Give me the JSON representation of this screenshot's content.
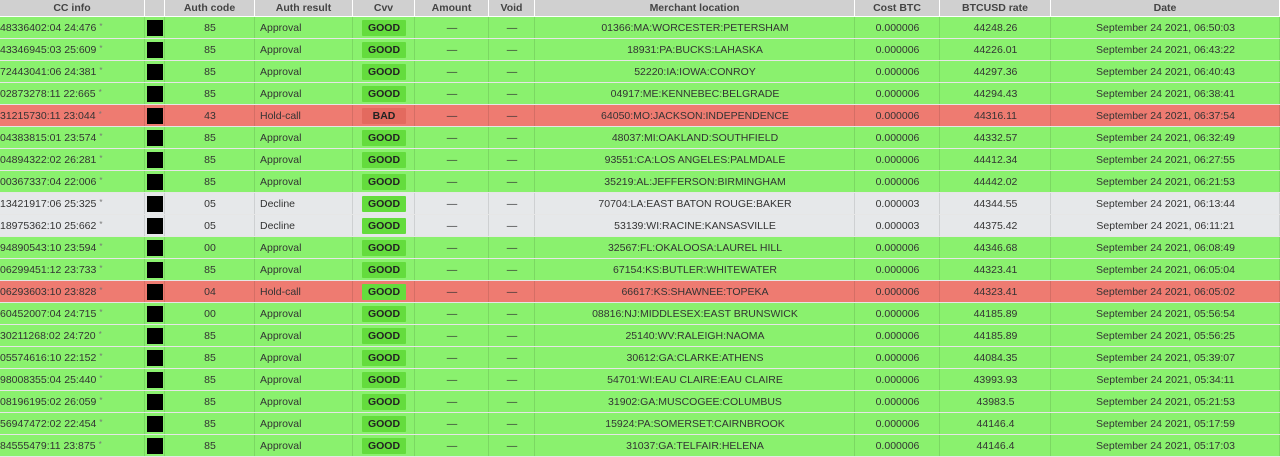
{
  "columns": [
    "CC info",
    "",
    "Auth code",
    "Auth result",
    "Cvv",
    "Amount",
    "Void",
    "Merchant location",
    "Cost BTC",
    "BTCUSD rate",
    "Date"
  ],
  "colors": {
    "approval": "#8af16e",
    "decline": "#e6e8ea",
    "hold": "#ee7b71",
    "cvv_good": "#64dc3d",
    "cvv_bad": "#e36a5f",
    "header": "#d0d0d0"
  },
  "rows": [
    {
      "status": "good",
      "cc": "48336402:04 24:476",
      "star": "*",
      "auth": "85",
      "result": "Approval",
      "cvv": "GOOD",
      "amount": "—",
      "void": "—",
      "merchant": "01366:MA:WORCESTER:PETERSHAM",
      "cost": "0.000006",
      "rate": "44248.26",
      "date": "September 24 2021, 06:50:03"
    },
    {
      "status": "good",
      "cc": "43346945:03 25:609",
      "star": "*",
      "auth": "85",
      "result": "Approval",
      "cvv": "GOOD",
      "amount": "—",
      "void": "—",
      "merchant": "18931:PA:BUCKS:LAHASKA",
      "cost": "0.000006",
      "rate": "44226.01",
      "date": "September 24 2021, 06:43:22"
    },
    {
      "status": "good",
      "cc": "72443041:06 24:381",
      "star": "*",
      "auth": "85",
      "result": "Approval",
      "cvv": "GOOD",
      "amount": "—",
      "void": "—",
      "merchant": "52220:IA:IOWA:CONROY",
      "cost": "0.000006",
      "rate": "44297.36",
      "date": "September 24 2021, 06:40:43"
    },
    {
      "status": "good",
      "cc": "02873278:11 22:665",
      "star": "*",
      "auth": "85",
      "result": "Approval",
      "cvv": "GOOD",
      "amount": "—",
      "void": "—",
      "merchant": "04917:ME:KENNEBEC:BELGRADE",
      "cost": "0.000006",
      "rate": "44294.43",
      "date": "September 24 2021, 06:38:41"
    },
    {
      "status": "bad",
      "cc": "31215730:11 23:044",
      "star": "*",
      "auth": "43",
      "result": "Hold-call",
      "cvv": "BAD",
      "amount": "—",
      "void": "—",
      "merchant": "64050:MO:JACKSON:INDEPENDENCE",
      "cost": "0.000006",
      "rate": "44316.11",
      "date": "September 24 2021, 06:37:54"
    },
    {
      "status": "good",
      "cc": "04383815:01 23:574",
      "star": "*",
      "auth": "85",
      "result": "Approval",
      "cvv": "GOOD",
      "amount": "—",
      "void": "—",
      "merchant": "48037:MI:OAKLAND:SOUTHFIELD",
      "cost": "0.000006",
      "rate": "44332.57",
      "date": "September 24 2021, 06:32:49"
    },
    {
      "status": "good",
      "cc": "04894322:02 26:281",
      "star": "*",
      "auth": "85",
      "result": "Approval",
      "cvv": "GOOD",
      "amount": "—",
      "void": "—",
      "merchant": "93551:CA:LOS ANGELES:PALMDALE",
      "cost": "0.000006",
      "rate": "44412.34",
      "date": "September 24 2021, 06:27:55"
    },
    {
      "status": "good",
      "cc": "00367337:04 22:006",
      "star": "*",
      "auth": "85",
      "result": "Approval",
      "cvv": "GOOD",
      "amount": "—",
      "void": "—",
      "merchant": "35219:AL:JEFFERSON:BIRMINGHAM",
      "cost": "0.000006",
      "rate": "44442.02",
      "date": "September 24 2021, 06:21:53"
    },
    {
      "status": "decline",
      "cc": "13421917:06 25:325",
      "star": "*",
      "auth": "05",
      "result": "Decline",
      "cvv": "GOOD",
      "amount": "—",
      "void": "—",
      "merchant": "70704:LA:EAST BATON ROUGE:BAKER",
      "cost": "0.000003",
      "rate": "44344.55",
      "date": "September 24 2021, 06:13:44"
    },
    {
      "status": "decline",
      "cc": "18975362:10 25:662",
      "star": "*",
      "auth": "05",
      "result": "Decline",
      "cvv": "GOOD",
      "amount": "—",
      "void": "—",
      "merchant": "53139:WI:RACINE:KANSASVILLE",
      "cost": "0.000003",
      "rate": "44375.42",
      "date": "September 24 2021, 06:11:21"
    },
    {
      "status": "good",
      "cc": "94890543:10 23:594",
      "star": "*",
      "auth": "00",
      "result": "Approval",
      "cvv": "GOOD",
      "amount": "—",
      "void": "—",
      "merchant": "32567:FL:OKALOOSA:LAUREL HILL",
      "cost": "0.000006",
      "rate": "44346.68",
      "date": "September 24 2021, 06:08:49"
    },
    {
      "status": "good",
      "cc": "06299451:12 23:733",
      "star": "*",
      "auth": "85",
      "result": "Approval",
      "cvv": "GOOD",
      "amount": "—",
      "void": "—",
      "merchant": "67154:KS:BUTLER:WHITEWATER",
      "cost": "0.000006",
      "rate": "44323.41",
      "date": "September 24 2021, 06:05:04"
    },
    {
      "status": "bad",
      "cc": "06293603:10 23:828",
      "star": "*",
      "auth": "04",
      "result": "Hold-call",
      "cvv": "GOOD",
      "amount": "—",
      "void": "—",
      "merchant": "66617:KS:SHAWNEE:TOPEKA",
      "cost": "0.000006",
      "rate": "44323.41",
      "date": "September 24 2021, 06:05:02"
    },
    {
      "status": "good",
      "cc": "60452007:04 24:715",
      "star": "*",
      "auth": "00",
      "result": "Approval",
      "cvv": "GOOD",
      "amount": "—",
      "void": "—",
      "merchant": "08816:NJ:MIDDLESEX:EAST BRUNSWICK",
      "cost": "0.000006",
      "rate": "44185.89",
      "date": "September 24 2021, 05:56:54"
    },
    {
      "status": "good",
      "cc": "30211268:02 24:720",
      "star": "*",
      "auth": "85",
      "result": "Approval",
      "cvv": "GOOD",
      "amount": "—",
      "void": "—",
      "merchant": "25140:WV:RALEIGH:NAOMA",
      "cost": "0.000006",
      "rate": "44185.89",
      "date": "September 24 2021, 05:56:25"
    },
    {
      "status": "good",
      "cc": "05574616:10 22:152",
      "star": "*",
      "auth": "85",
      "result": "Approval",
      "cvv": "GOOD",
      "amount": "—",
      "void": "—",
      "merchant": "30612:GA:CLARKE:ATHENS",
      "cost": "0.000006",
      "rate": "44084.35",
      "date": "September 24 2021, 05:39:07"
    },
    {
      "status": "good",
      "cc": "98008355:04 25:440",
      "star": "*",
      "auth": "85",
      "result": "Approval",
      "cvv": "GOOD",
      "amount": "—",
      "void": "—",
      "merchant": "54701:WI:EAU CLAIRE:EAU CLAIRE",
      "cost": "0.000006",
      "rate": "43993.93",
      "date": "September 24 2021, 05:34:11"
    },
    {
      "status": "good",
      "cc": "08196195:02 26:059",
      "star": "*",
      "auth": "85",
      "result": "Approval",
      "cvv": "GOOD",
      "amount": "—",
      "void": "—",
      "merchant": "31902:GA:MUSCOGEE:COLUMBUS",
      "cost": "0.000006",
      "rate": "43983.5",
      "date": "September 24 2021, 05:21:53"
    },
    {
      "status": "good",
      "cc": "56947472:02 22:454",
      "star": "*",
      "auth": "85",
      "result": "Approval",
      "cvv": "GOOD",
      "amount": "—",
      "void": "—",
      "merchant": "15924:PA:SOMERSET:CAIRNBROOK",
      "cost": "0.000006",
      "rate": "44146.4",
      "date": "September 24 2021, 05:17:59"
    },
    {
      "status": "good",
      "cc": "84555479:11 23:875",
      "star": "*",
      "auth": "85",
      "result": "Approval",
      "cvv": "GOOD",
      "amount": "—",
      "void": "—",
      "merchant": "31037:GA:TELFAIR:HELENA",
      "cost": "0.000006",
      "rate": "44146.4",
      "date": "September 24 2021, 05:17:03"
    }
  ]
}
